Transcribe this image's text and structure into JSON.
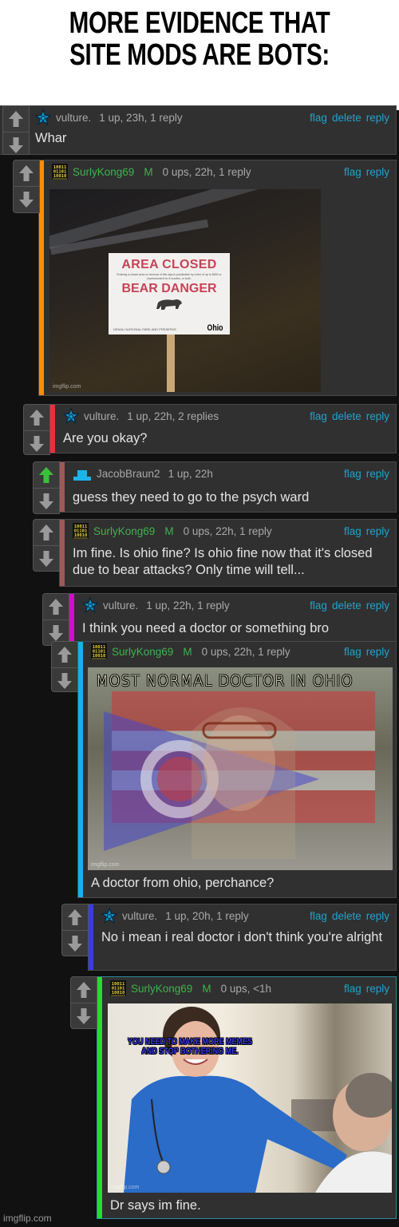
{
  "header": {
    "title": "MORE EVIDENCE THAT\nSITE MODS ARE BOTS:"
  },
  "colors": {
    "background": "#111111",
    "comment_bg": "#303030",
    "link": "#1fa3d0",
    "mod_name": "#3fb24f",
    "meta_text": "#a9a9a9",
    "body_text": "#e4e4e4",
    "upvoted": "#3cbf3c"
  },
  "icons": {
    "upvote": "up-arrow-icon",
    "downvote": "down-arrow-icon",
    "vulture_avatar": "blue-star-avatar-icon",
    "surly_avatar": "binary-code-avatar-icon",
    "jacob_avatar": "blue-hat-avatar-icon"
  },
  "comments": [
    {
      "username": "vulture.",
      "is_mod": false,
      "badge": "",
      "stats": "1 up, 23h, 1 reply",
      "actions": [
        "flag",
        "delete",
        "reply"
      ],
      "text": "Whar",
      "bar_color": "",
      "upvoted": false
    },
    {
      "username": "SurlyKong69",
      "is_mod": true,
      "badge": "M",
      "stats": "0 ups, 22h, 1 reply",
      "actions": [
        "flag",
        "reply"
      ],
      "text": "",
      "bar_color": "#ff8c00",
      "upvoted": false,
      "image": {
        "alt": "Area closed bear danger sign edited with Ohio",
        "sign_line1": "AREA CLOSED",
        "sign_small": "Entering a closed area or removal of this sign is punishable by a fine of up to $500 or imprisonment for 6 months, or both.",
        "sign_line2": "BEAR DANGER",
        "sign_footer": "DENALI NATIONAL PARK AND PRESERVE",
        "sign_overlay": "Ohio",
        "watermark": "imgflip.com"
      }
    },
    {
      "username": "vulture.",
      "is_mod": false,
      "badge": "",
      "stats": "1 up, 22h, 2 replies",
      "actions": [
        "flag",
        "delete",
        "reply"
      ],
      "text": "Are you okay?",
      "bar_color": "#e8303a",
      "upvoted": false
    },
    {
      "username": "JacobBraun2",
      "is_mod": false,
      "badge": "",
      "stats": "1 up, 22h",
      "actions": [
        "flag",
        "reply"
      ],
      "text": "guess they need to go to the psych ward",
      "bar_color": "#a05858",
      "upvoted": true
    },
    {
      "username": "SurlyKong69",
      "is_mod": true,
      "badge": "M",
      "stats": "0 ups, 22h, 1 reply",
      "actions": [
        "flag",
        "reply"
      ],
      "text": "Im fine. Is ohio fine? Is ohio fine now that it's closed due to bear attacks? Only time will tell...",
      "bar_color": "#a05858",
      "upvoted": false
    },
    {
      "username": "vulture.",
      "is_mod": false,
      "badge": "",
      "stats": "1 up, 22h, 1 reply",
      "actions": [
        "flag",
        "delete",
        "reply"
      ],
      "text": "I think you need a doctor or something bro",
      "bar_color": "#d010c8",
      "upvoted": false
    },
    {
      "username": "SurlyKong69",
      "is_mod": true,
      "badge": "M",
      "stats": "0 ups, 22h, 1 reply",
      "actions": [
        "flag",
        "reply"
      ],
      "text": "A doctor from ohio, perchance?",
      "bar_color": "#18b0e8",
      "upvoted": false,
      "image": {
        "alt": "Wild-haired doctor with Ohio flag overlay",
        "caption": "MOST NORMAL DOCTOR IN OHIO",
        "watermark": "imgflip.com"
      }
    },
    {
      "username": "vulture.",
      "is_mod": false,
      "badge": "",
      "stats": "1 up, 20h, 1 reply",
      "actions": [
        "flag",
        "delete",
        "reply"
      ],
      "text": "No i mean i real doctor i don't think you're alright",
      "bar_color": "#3a3ae8",
      "upvoted": false
    },
    {
      "username": "SurlyKong69",
      "is_mod": true,
      "badge": "M",
      "stats": "0 ups, <1h",
      "actions": [
        "flag",
        "reply"
      ],
      "text": "Dr says im fine.",
      "bar_color": "#22dd33",
      "upvoted": false,
      "image": {
        "alt": "Smiling nurse talking to patient",
        "caption": "YOU NEED TO MAKE MORE MEMES AND STOP BOTHERING ME.",
        "watermark": "imgflip.com"
      }
    }
  ],
  "footer": {
    "watermark": "imgflip.com"
  }
}
